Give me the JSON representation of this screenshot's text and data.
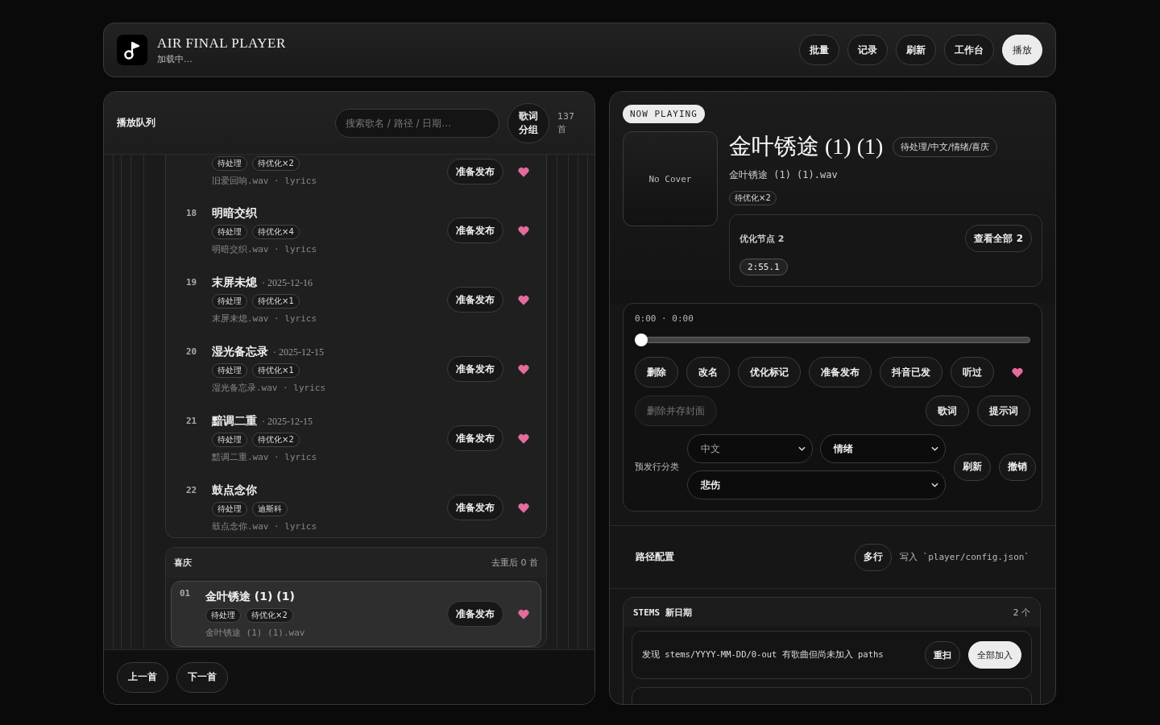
{
  "app": {
    "title": "AIR FINAL PLAYER",
    "subtitle": "加载中…"
  },
  "header_buttons": [
    {
      "label": "批量",
      "primary": false
    },
    {
      "label": "记录",
      "primary": false
    },
    {
      "label": "刷新",
      "primary": false
    },
    {
      "label": "工作台",
      "primary": false
    },
    {
      "label": "播放",
      "primary": true
    }
  ],
  "queue": {
    "title": "播放队列",
    "search_placeholder": "搜索歌名 / 路径 / 日期…",
    "group_button": "歌词分组",
    "count": "137\n首",
    "groups": [
      {
        "items": [
          {
            "tags": [
              "待处理",
              "待优化×2"
            ],
            "file": "旧爱回响.wav · lyrics",
            "action": "准备发布",
            "liked": true,
            "selected": false
          },
          {
            "num": "18",
            "title": "明暗交织",
            "tags": [
              "待处理",
              "待优化×4"
            ],
            "file": "明暗交织.wav · lyrics",
            "action": "准备发布",
            "liked": true,
            "selected": false
          },
          {
            "num": "19",
            "title": "末屏未熄",
            "date": "· 2025-12-16",
            "tags": [
              "待处理",
              "待优化×1"
            ],
            "file": "末屏未熄.wav · lyrics",
            "action": "准备发布",
            "liked": true,
            "selected": false
          },
          {
            "num": "20",
            "title": "湿光备忘录",
            "date": "· 2025-12-15",
            "tags": [
              "待处理",
              "待优化×1"
            ],
            "file": "湿光备忘录.wav · lyrics",
            "action": "准备发布",
            "liked": true,
            "selected": false
          },
          {
            "num": "21",
            "title": "黯调二重",
            "date": "· 2025-12-15",
            "tags": [
              "待处理",
              "待优化×2"
            ],
            "file": "黯调二重.wav · lyrics",
            "action": "准备发布",
            "liked": true,
            "selected": false
          },
          {
            "num": "22",
            "title": "鼓点念你",
            "tags": [
              "待处理",
              "迪斯科"
            ],
            "file": "鼓点念你.wav · lyrics",
            "action": "准备发布",
            "liked": true,
            "selected": false
          }
        ]
      },
      {
        "name": "喜庆",
        "summary": "去重后 0 首",
        "items": [
          {
            "num": "01",
            "title": "金叶锈途 (1) (1)",
            "tags": [
              "待处理",
              "待优化×2"
            ],
            "file": "金叶锈途 (1) (1).wav",
            "action": "准备发布",
            "liked": true,
            "selected": true
          }
        ]
      }
    ],
    "footer_buttons": [
      "上一首",
      "下一首"
    ]
  },
  "now_playing": {
    "badge": "NOW PLAYING",
    "cover": "No Cover",
    "title": "金叶锈途 (1) (1)",
    "category": "待处理/中文/情绪/喜庆",
    "file": "金叶锈途 (1) (1).wav",
    "tags": [
      "待优化×2"
    ],
    "nodes": {
      "label": "优化节点 2",
      "view_all": "查看全部 2",
      "times": [
        "2:55.1"
      ]
    }
  },
  "player": {
    "time": "0:00 · 0:00",
    "level": 0,
    "actions": [
      {
        "label": "删除",
        "disabled": false
      },
      {
        "label": "改名",
        "disabled": false
      },
      {
        "label": "优化标记",
        "disabled": false
      },
      {
        "label": "准备发布",
        "disabled": false
      },
      {
        "label": "抖音已发",
        "disabled": false
      },
      {
        "label": "听过",
        "disabled": false
      }
    ],
    "liked": true,
    "secondary": [
      {
        "label": "删除并存封面",
        "disabled": true
      }
    ],
    "right_buttons": [
      "歌词",
      "提示词"
    ],
    "classify": {
      "label": "预发行分类",
      "selects": [
        {
          "value": "中文",
          "muted": true
        },
        {
          "value": "情绪",
          "muted": false
        },
        {
          "value": "悲伤",
          "muted": false
        }
      ],
      "buttons": [
        "刷新",
        "撤销"
      ]
    }
  },
  "path_config": {
    "title": "路径配置",
    "button": "多行",
    "note": "写入 `player/config.json`"
  },
  "stems": {
    "title": "STEMS 新日期",
    "count": "2 个",
    "notice": "发现 stems/YYYY-MM-DD/0-out 有歌曲但尚未加入 paths",
    "buttons": [
      {
        "label": "重扫",
        "primary": false
      },
      {
        "label": "全部加入",
        "primary": true
      }
    ]
  }
}
